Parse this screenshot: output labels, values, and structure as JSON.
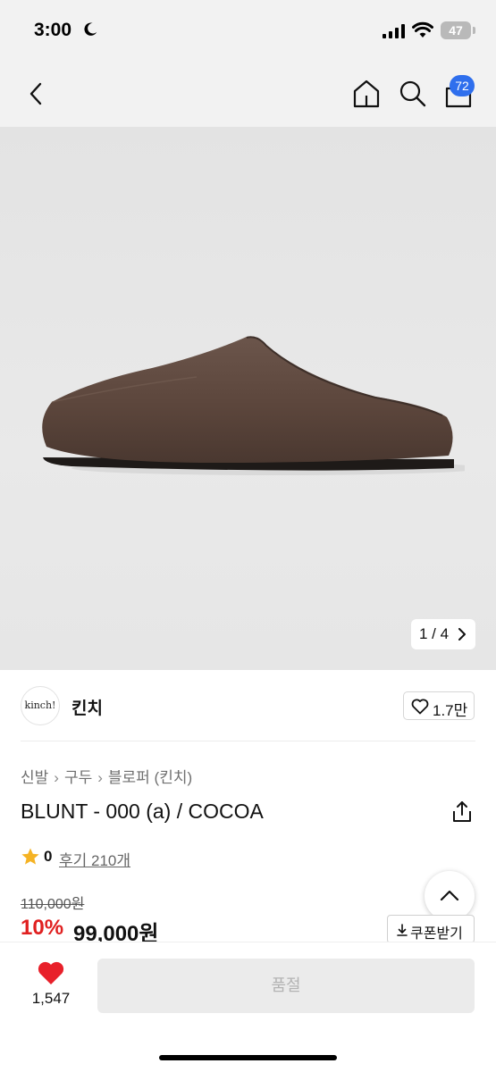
{
  "status_bar": {
    "time": "3:00",
    "battery": "47"
  },
  "nav": {
    "cart_badge": "72"
  },
  "gallery": {
    "counter": "1 / 4"
  },
  "brand": {
    "logo_text": "kinch!",
    "name": "킨치",
    "like_count": "1.7만"
  },
  "breadcrumb": {
    "items": [
      "신발",
      "구두",
      "블로퍼 (킨치)"
    ]
  },
  "product": {
    "title": "BLUNT - 000 (a) / COCOA",
    "rating": "0",
    "reviews": "후기 210개",
    "original_price": "110,000원",
    "discount": "10%",
    "sale_price": "99,000원",
    "coupon_label": "쿠폰받기"
  },
  "bottom_bar": {
    "wish_count": "1,547",
    "buy_button_label": "품절"
  },
  "colors": {
    "accent_blue": "#2f6fed",
    "discount_red": "#e02020",
    "heart_red": "#e8202a",
    "star": "#f5b324"
  }
}
